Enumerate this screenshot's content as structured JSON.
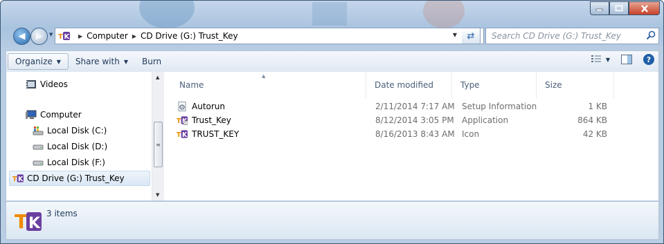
{
  "titlebar": {
    "buttons": [
      "minimize",
      "maximize",
      "close"
    ],
    "close_color": "#c7432a"
  },
  "address": {
    "breadcrumbs": [
      "Computer",
      "CD Drive (G:) Trust_Key"
    ],
    "search_placeholder": "Search CD Drive (G:) Trust_Key"
  },
  "toolbar": {
    "organize": "Organize",
    "share_with": "Share with",
    "burn": "Burn"
  },
  "nav": {
    "items": [
      {
        "label": "Videos",
        "icon": "videos-folder-icon"
      },
      {
        "label": "Computer",
        "icon": "computer-icon"
      },
      {
        "label": "Local Disk (C:)",
        "icon": "windows-drive-icon"
      },
      {
        "label": "Local Disk (D:)",
        "icon": "drive-icon"
      },
      {
        "label": "Local Disk (F:)",
        "icon": "drive-icon"
      },
      {
        "label": "CD Drive (G:) Trust_Key",
        "icon": "trustkey-icon",
        "selected": true
      }
    ]
  },
  "columns": {
    "name": "Name",
    "date": "Date modified",
    "type": "Type",
    "size": "Size"
  },
  "files": [
    {
      "name": "Autorun",
      "date": "2/11/2014 7:17 AM",
      "type": "Setup Information",
      "size": "1 KB",
      "icon": "setup-info-icon"
    },
    {
      "name": "Trust_Key",
      "date": "8/12/2014 3:05 PM",
      "type": "Application",
      "size": "864 KB",
      "icon": "trustkey-app-icon"
    },
    {
      "name": "TRUST_KEY",
      "date": "8/16/2013 8:43 AM",
      "type": "Icon",
      "size": "42 KB",
      "icon": "trustkey-icon"
    }
  ],
  "status": {
    "count_text": "3 items",
    "accent": "#6b3fa0"
  }
}
